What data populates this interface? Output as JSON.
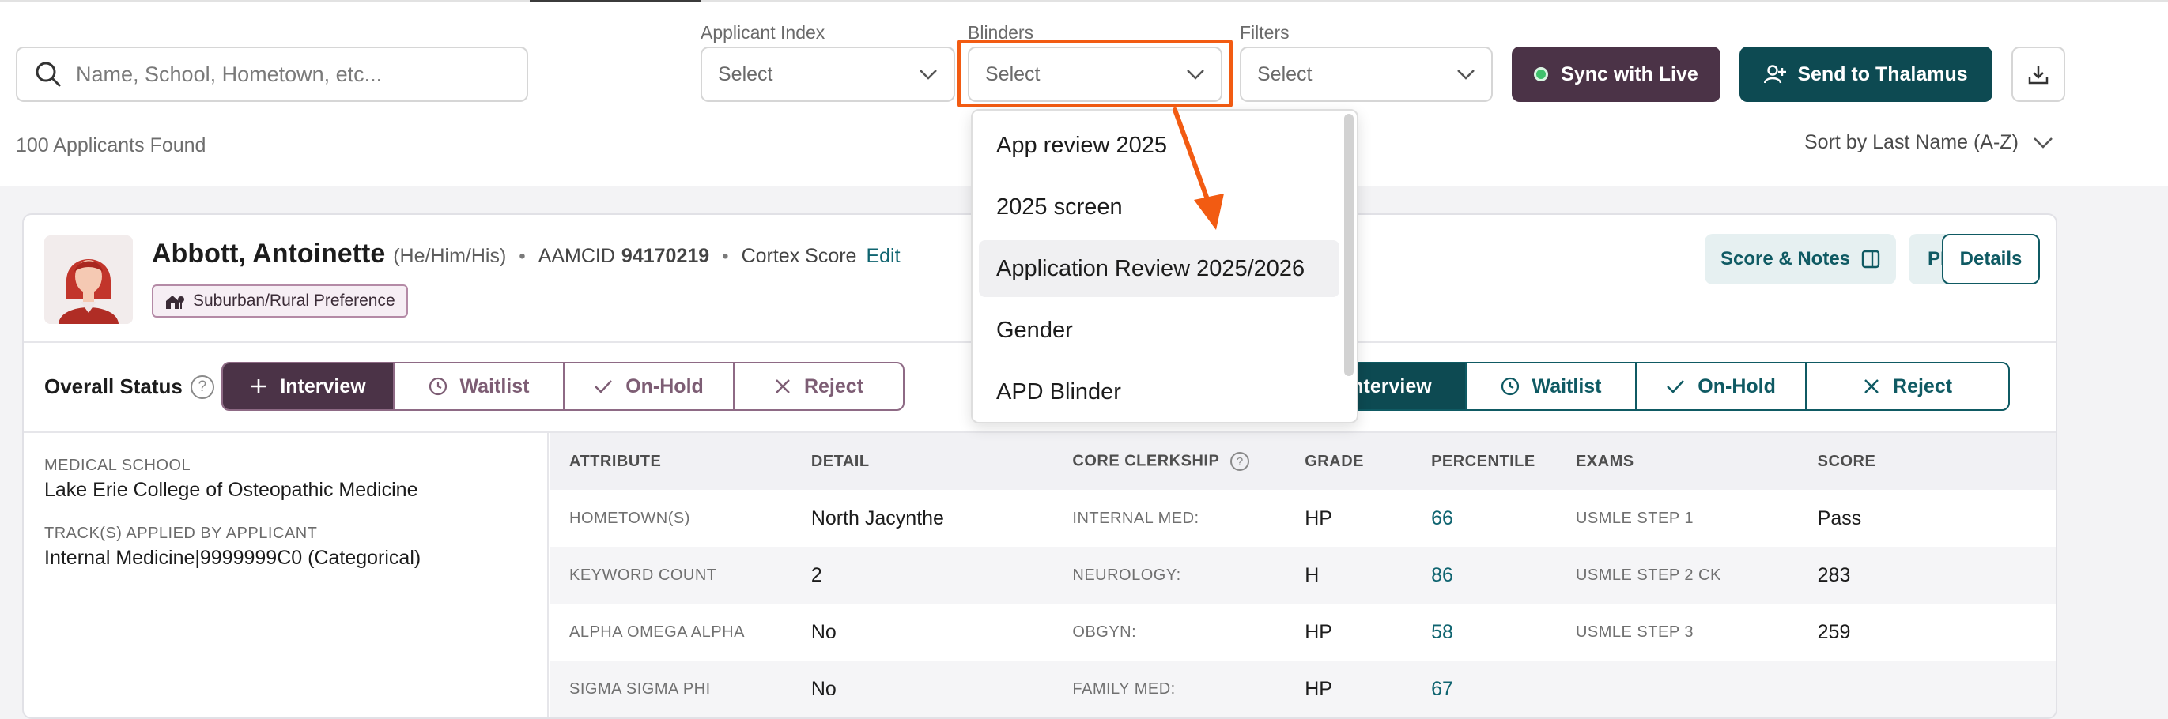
{
  "search": {
    "placeholder": "Name, School, Hometown, etc..."
  },
  "filters": {
    "applicant_index": {
      "label": "Applicant Index",
      "value": "Select"
    },
    "blinders": {
      "label": "Blinders",
      "value": "Select"
    },
    "filters": {
      "label": "Filters",
      "value": "Select"
    }
  },
  "buttons": {
    "sync": "Sync with Live",
    "send": "Send to Thalamus"
  },
  "results": {
    "count": "100 Applicants Found",
    "sort": "Sort by Last Name (A-Z)"
  },
  "blinders_dropdown": {
    "options": [
      "App review 2025",
      "2025 screen",
      "Application Review 2025/2026",
      "Gender",
      "APD Blinder"
    ],
    "hovered": "Application Review 2025/2026"
  },
  "applicant": {
    "name": "Abbott, Antoinette",
    "pronouns": "(He/Him/His)",
    "aamcid_label": "AAMCID",
    "aamcid": "94170219",
    "cortex_label": "Cortex Score",
    "edit": "Edit",
    "badge": "Suburban/Rural Preference",
    "actions": {
      "score_notes": "Score & Notes",
      "pdf": "PDF",
      "details": "Details"
    }
  },
  "status": {
    "label": "Overall Status",
    "options": [
      "Interview",
      "Waitlist",
      "On-Hold",
      "Reject"
    ]
  },
  "school": {
    "medical_school_label": "MEDICAL SCHOOL",
    "medical_school": "Lake Erie College of Osteopathic Medicine",
    "tracks_label": "TRACK(S) APPLIED BY APPLICANT",
    "tracks": "Internal Medicine|9999999C0 (Categorical)"
  },
  "table": {
    "headers": [
      "ATTRIBUTE",
      "DETAIL",
      "CORE CLERKSHIP",
      "GRADE",
      "PERCENTILE",
      "EXAMS",
      "SCORE"
    ],
    "rows": [
      [
        "HOMETOWN(S)",
        "North Jacynthe",
        "INTERNAL MED:",
        "HP",
        "66",
        "USMLE STEP 1",
        "Pass"
      ],
      [
        "KEYWORD COUNT",
        "2",
        "NEUROLOGY:",
        "H",
        "86",
        "USMLE STEP 2 CK",
        "283"
      ],
      [
        "ALPHA OMEGA ALPHA",
        "No",
        "OBGYN:",
        "HP",
        "58",
        "USMLE STEP 3",
        "259"
      ],
      [
        "SIGMA SIGMA PHI",
        "No",
        "FAMILY MED:",
        "HP",
        "67",
        "",
        ""
      ]
    ]
  },
  "colors": {
    "plum": "#4b3347",
    "teal": "#0d4a52",
    "highlight": "#f25b12"
  }
}
